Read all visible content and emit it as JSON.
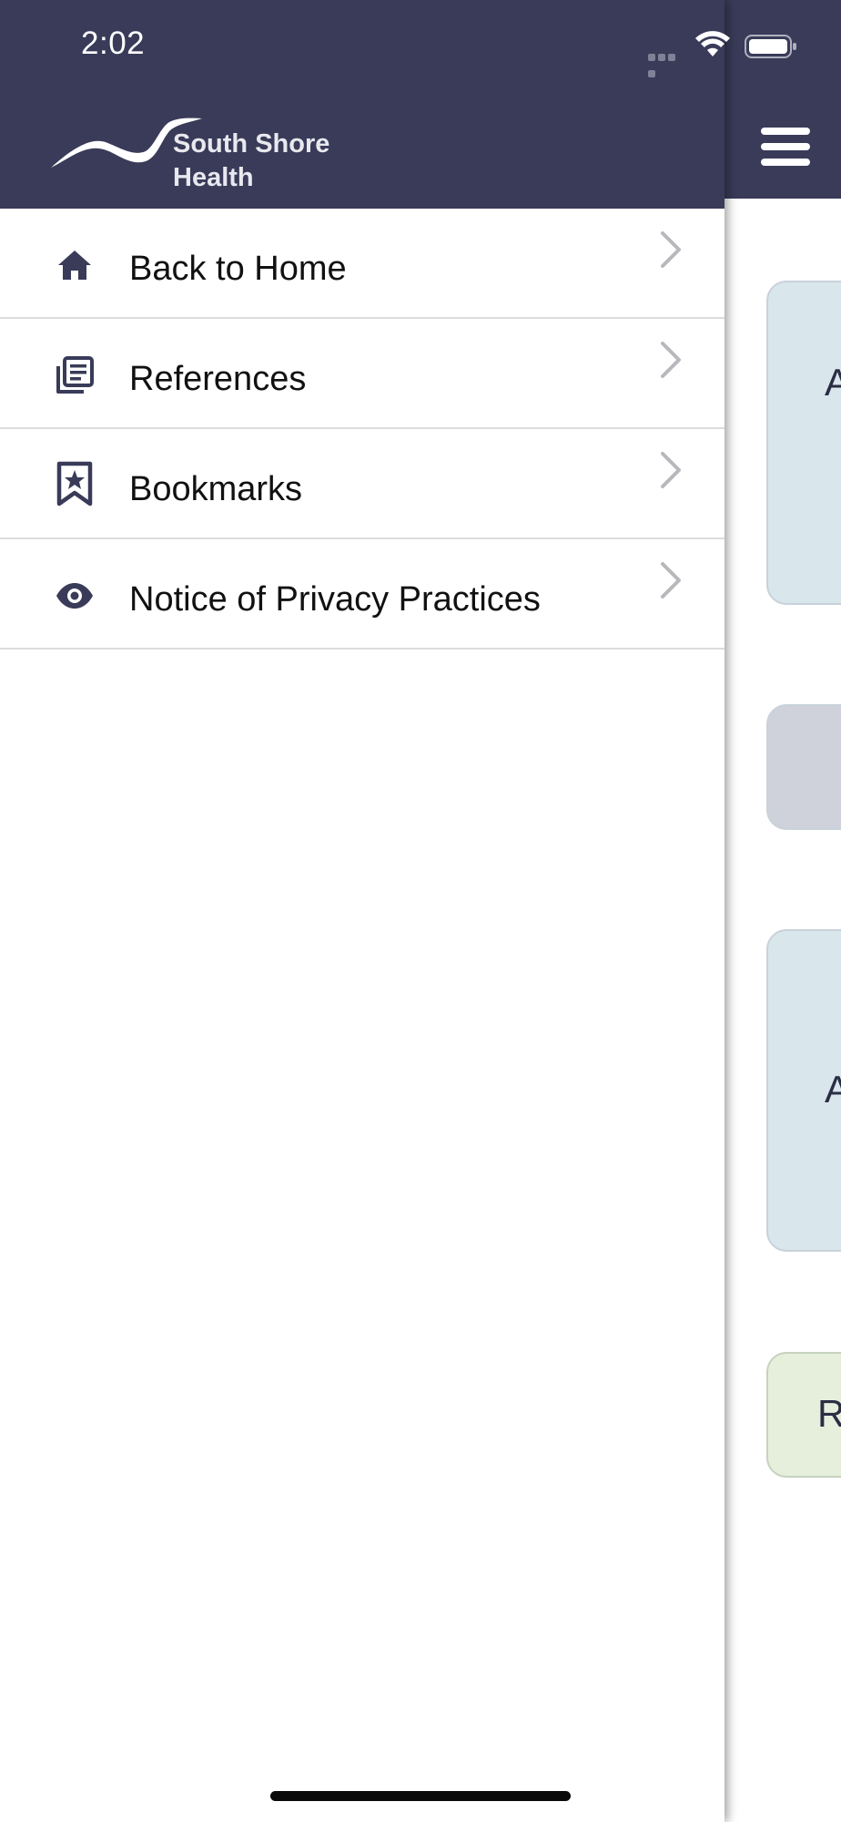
{
  "status_bar": {
    "time": "2:02",
    "icons": [
      "signal-dots-icon",
      "wifi-icon",
      "battery-icon"
    ]
  },
  "drawer": {
    "logo": {
      "line1": "South Shore",
      "line2": "Health"
    },
    "menu_items": [
      {
        "label": "Back to Home",
        "icon": "home-icon"
      },
      {
        "label": "References",
        "icon": "references-icon"
      },
      {
        "label": "Bookmarks",
        "icon": "bookmark-star-icon"
      },
      {
        "label": "Notice of Privacy Practices",
        "icon": "eye-icon"
      }
    ]
  },
  "background_app": {
    "header_icon": "hamburger-menu-icon",
    "cards": [
      {
        "letter": "A"
      },
      {
        "letter": ""
      },
      {
        "letter": "A"
      },
      {
        "letter": "R"
      }
    ]
  },
  "colors": {
    "header_bg": "#393b59",
    "icon_color": "#393b59",
    "chevron_color": "#b8b8bc",
    "divider": "#dcdcdf"
  }
}
